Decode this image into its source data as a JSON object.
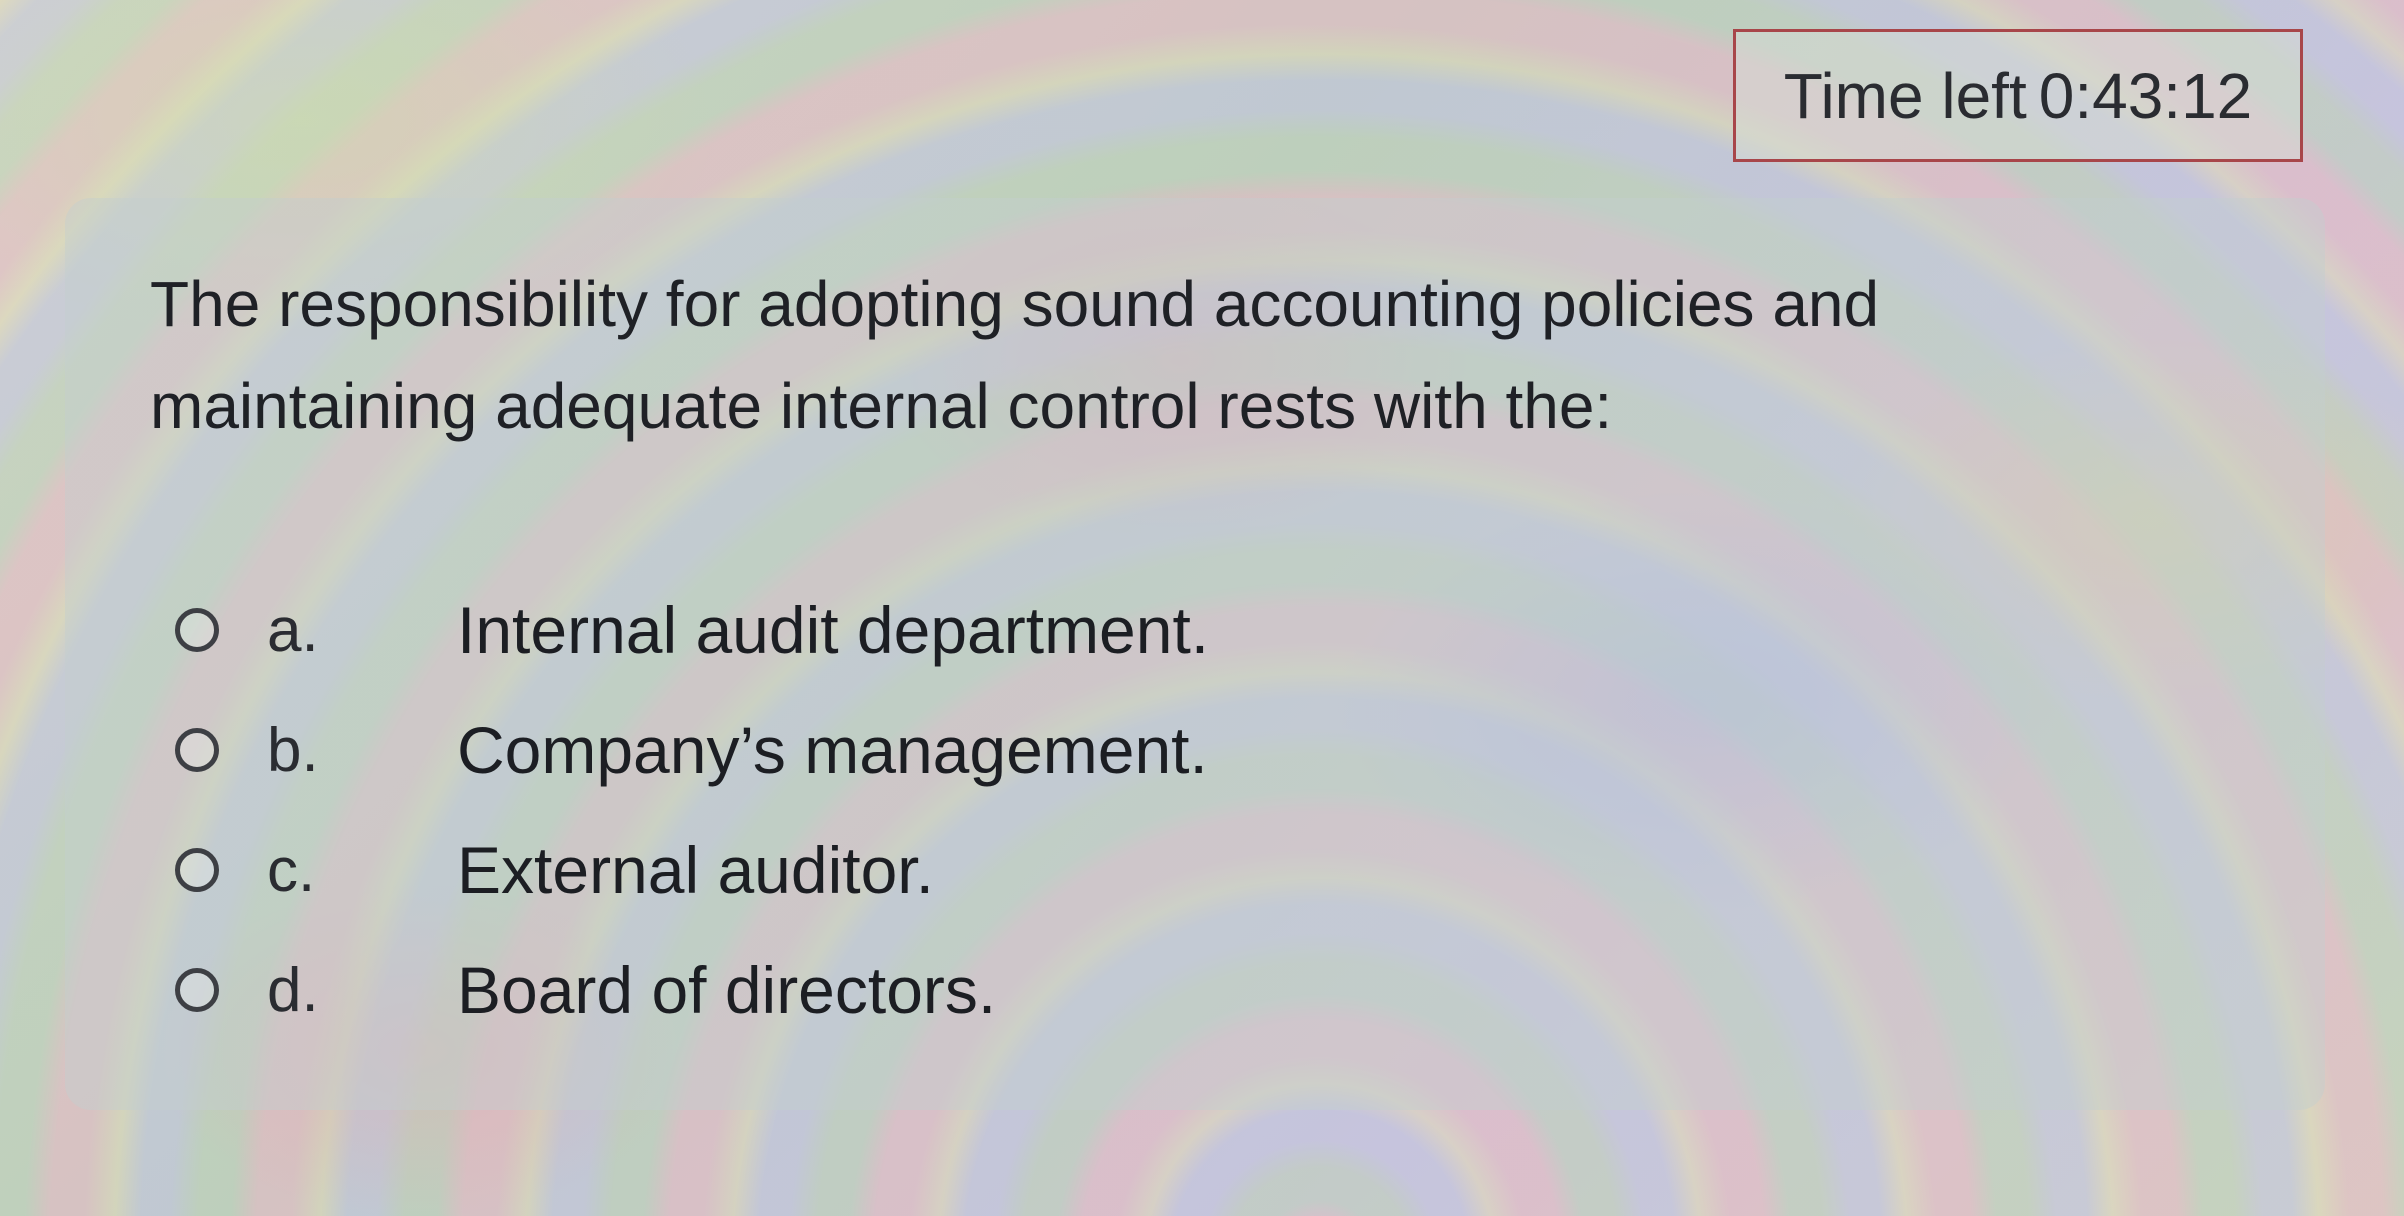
{
  "timer": {
    "label": "Time left",
    "value": "0:43:12",
    "border_color": "#a8464a"
  },
  "question": {
    "text": "The responsibility for adopting sound accounting policies and maintaining adequate internal control rests with the:"
  },
  "answers": [
    {
      "letter": "a.",
      "text": "Internal audit department.",
      "selected": false
    },
    {
      "letter": "b.",
      "text": "Company’s management.",
      "selected": false
    },
    {
      "letter": "c.",
      "text": "External auditor.",
      "selected": false
    },
    {
      "letter": "d.",
      "text": "Board of directors.",
      "selected": false
    }
  ],
  "icons": {
    "radio": "radio-button-icon"
  }
}
